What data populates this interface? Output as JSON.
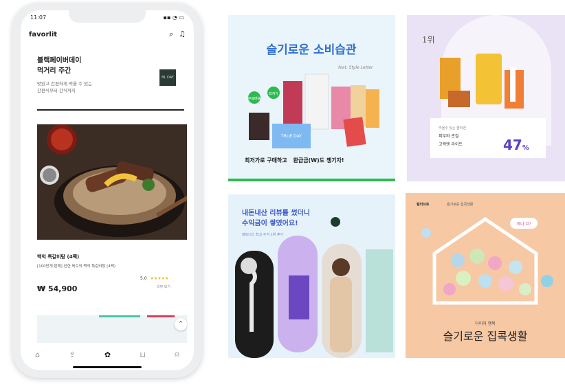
{
  "phone": {
    "status_time": "11:07",
    "app_title": "favorlit",
    "banner_title_1": "블랙페이버데이",
    "banner_title_2": "먹거리 주간",
    "banner_desc_1": "맛있고 간편하게 먹을 수 있는",
    "banner_desc_2": "간편식부터 간식까지",
    "badge_text": "BL DAY",
    "product_name": "백억 특갈비탕 (4팩)",
    "product_sub": "[100만개 판매] 진한 육수의 백억 특갈비탕 (4팩)",
    "rating_value": "5.0",
    "rating_stars": "★★★★★",
    "review_link": "리뷰 보기",
    "price": "₩ 54,900",
    "tab_icons": [
      "home-icon",
      "share-icon",
      "flower-icon",
      "cart-icon",
      "user-icon"
    ]
  },
  "card1": {
    "headline": "슬기로운 소비습관",
    "tag_1": "무료배송",
    "tag_2": "최저가",
    "box_label": "TRUE DAY",
    "caption_a": "최저가로 구매하고",
    "caption_b": "환급금(W)도 챙기자!"
  },
  "card2": {
    "rank": "1위",
    "box_title_1": "먹을수 있는 콜라겐",
    "box_title_2": "피부와 관절",
    "box_title_3": "고백엔 라이트",
    "percent": "47",
    "percent_suffix": "%"
  },
  "card3": {
    "headline_1": "내돈내산 리뷰를 썼더니",
    "headline_2": "수익금이 쌓였어요!",
    "subline": "파트너스 최고 수익 1위 후기"
  },
  "card4": {
    "brand": "캘리브로",
    "brand_sub": "슬기로운 집콕생활",
    "tag": "하나 더!",
    "small": "다이어 행복",
    "headline": "슬기로운 집콕생활"
  }
}
